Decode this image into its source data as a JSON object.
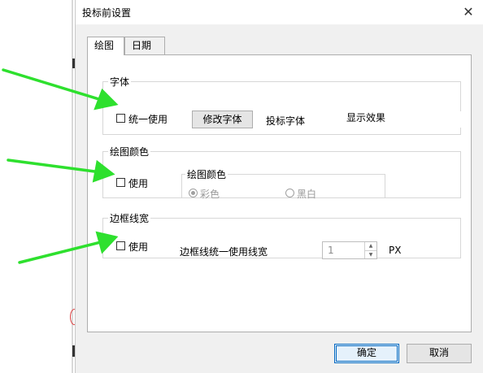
{
  "dialog": {
    "title": "投标前设置",
    "close_glyph": "✕",
    "tabs": [
      {
        "label": "绘图"
      },
      {
        "label": "日期"
      }
    ],
    "font_group": {
      "legend": "字体",
      "checkbox_label": "统一使用",
      "modify_button": "修改字体",
      "bid_font_label": "投标字体",
      "preview_label": "显示效果"
    },
    "color_group": {
      "legend": "绘图颜色",
      "checkbox_label": "使用",
      "inner_legend": "绘图颜色",
      "radio_color": "彩色",
      "radio_bw": "黑白"
    },
    "border_group": {
      "legend": "边框线宽",
      "checkbox_label": "使用",
      "width_label": "边框线统一使用线宽",
      "width_value": "1",
      "unit": "PX"
    },
    "ok_button": "确定",
    "cancel_button": "取消"
  },
  "colors": {
    "arrow": "#2ee02e",
    "accent": "#0067c0"
  }
}
